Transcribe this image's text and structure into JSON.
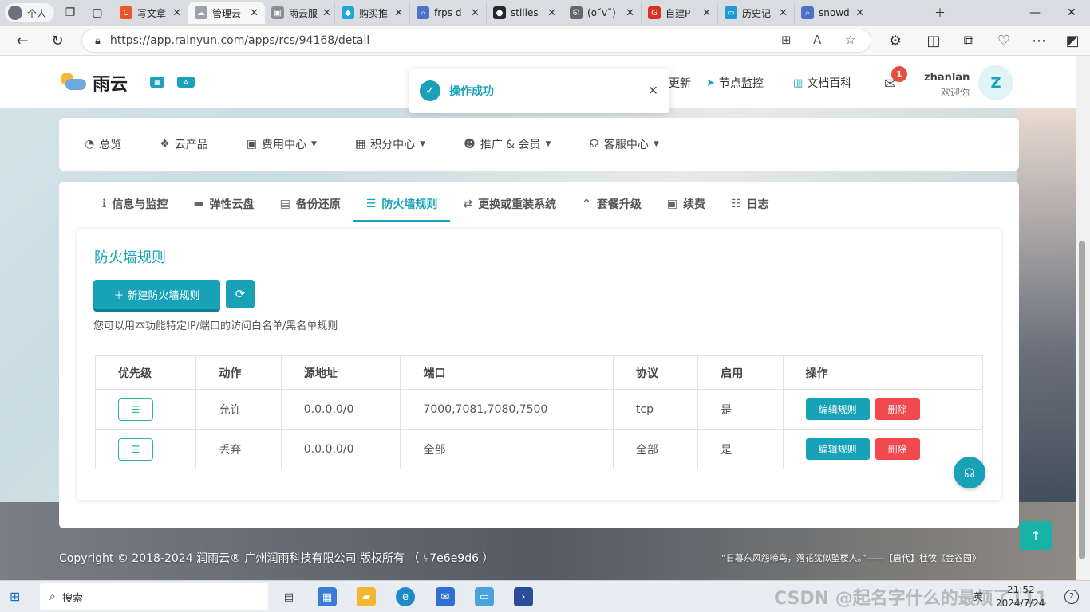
{
  "browser": {
    "profile": "个人",
    "tabs": [
      {
        "title": "写文章",
        "fav": "C",
        "color": "#e8562a"
      },
      {
        "title": "管理云",
        "fav": "☁",
        "color": "#9aa3ad",
        "active": true
      },
      {
        "title": "雨云服",
        "fav": "▣",
        "color": "#8b8f94"
      },
      {
        "title": "购买推",
        "fav": "◆",
        "color": "#21a6d9"
      },
      {
        "title": "frps d",
        "fav": "⌕",
        "color": "#4a73c7"
      },
      {
        "title": "stilles",
        "fav": "●",
        "color": "#24292e"
      },
      {
        "title": "(o˘v˘)",
        "fav": "ᘏ",
        "color": "#666"
      },
      {
        "title": "自建P",
        "fav": "G",
        "color": "#d93025"
      },
      {
        "title": "历史记",
        "fav": "▭",
        "color": "#1e9bd7"
      },
      {
        "title": "snowd",
        "fav": "⌕",
        "color": "#4a73c7"
      }
    ],
    "url": "https://app.rainyun.com/apps/rcs/94168/detail"
  },
  "header": {
    "brand": "雨云",
    "links": [
      {
        "icon": "➤",
        "label": "节点监控"
      },
      {
        "icon": "▥",
        "label": "文档百科"
      }
    ],
    "partial_link": "更新",
    "mail_badge": "1",
    "username": "zhanlan",
    "welcome": "欢迎你",
    "avatar_letter": "Z"
  },
  "toast": {
    "message": "操作成功"
  },
  "menu": [
    {
      "icon": "◔",
      "label": "总览",
      "dropdown": false
    },
    {
      "icon": "❖",
      "label": "云产品",
      "dropdown": false
    },
    {
      "icon": "▣",
      "label": "费用中心",
      "dropdown": true
    },
    {
      "icon": "▦",
      "label": "积分中心",
      "dropdown": true
    },
    {
      "icon": "☻",
      "label": "推广 & 会员",
      "dropdown": true
    },
    {
      "icon": "☊",
      "label": "客服中心",
      "dropdown": true
    }
  ],
  "detail_tabs": [
    {
      "icon": "ℹ",
      "label": "信息与监控"
    },
    {
      "icon": "▬",
      "label": "弹性云盘"
    },
    {
      "icon": "▤",
      "label": "备份还原"
    },
    {
      "icon": "☰",
      "label": "防火墙规则",
      "active": true
    },
    {
      "icon": "⇄",
      "label": "更换或重装系统"
    },
    {
      "icon": "⌃",
      "label": "套餐升级"
    },
    {
      "icon": "▣",
      "label": "续费"
    },
    {
      "icon": "☷",
      "label": "日志"
    }
  ],
  "firewall": {
    "title": "防火墙规则",
    "new_button": "新建防火墙规则",
    "hint": "您可以用本功能特定IP/端口的访问白名单/黑名单规则",
    "columns": [
      "优先级",
      "动作",
      "源地址",
      "端口",
      "协议",
      "启用",
      "操作"
    ],
    "rows": [
      {
        "action": "允许",
        "source": "0.0.0.0/0",
        "port": "7000,7081,7080,7500",
        "protocol": "tcp",
        "enabled": "是"
      },
      {
        "action": "丢弃",
        "source": "0.0.0.0/0",
        "port": "全部",
        "protocol": "全部",
        "enabled": "是"
      }
    ],
    "edit_label": "编辑规则",
    "delete_label": "删除"
  },
  "footer": {
    "copyright": "Copyright © 2018-2024 润雨云® 广州润雨科技有限公司 版权所有 （ ⑂7e6e9d6 ）",
    "quote": "“日暮东风怨啼鸟，落花犹似坠楼人。”——【唐代】杜牧《金谷园》"
  },
  "taskbar": {
    "search": "搜索",
    "ime": "英",
    "time": "21:52",
    "date": "2024/7/24",
    "notifications": "2",
    "watermark": "CSDN @起名字什么的最烦了111"
  },
  "colors": {
    "accent": "#17a2b8",
    "danger": "#f0494f"
  }
}
